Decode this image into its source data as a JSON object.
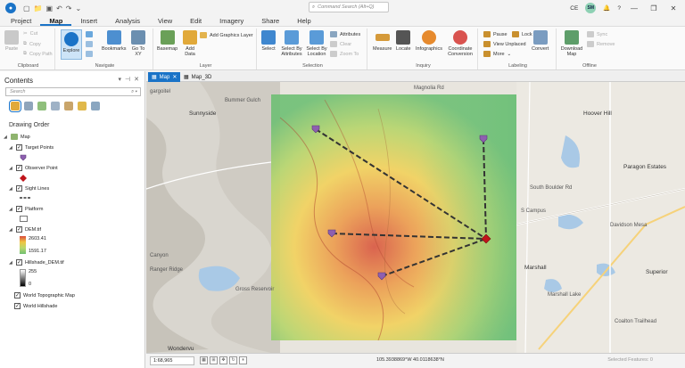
{
  "titlebar": {
    "command_search": "Command Search (Alt+Q)",
    "user_initials": "CE",
    "avatar_initials": "SM",
    "help": "?",
    "minimize": "—",
    "restore": "❐",
    "close": "✕"
  },
  "ribbon_tabs": [
    "Project",
    "Map",
    "Insert",
    "Analysis",
    "View",
    "Edit",
    "Imagery",
    "Share",
    "Help"
  ],
  "ribbon": {
    "clipboard": {
      "label": "Clipboard",
      "paste": "Paste",
      "cut": "Cut",
      "copy": "Copy",
      "copy_path": "Copy Path"
    },
    "navigate": {
      "label": "Navigate",
      "explore": "Explore",
      "bookmarks": "Bookmarks",
      "goto": "Go To XY"
    },
    "layer": {
      "label": "Layer",
      "basemap": "Basemap",
      "add_data": "Add Data",
      "add_graphics": "Add Graphics Layer"
    },
    "selection": {
      "label": "Selection",
      "select": "Select",
      "by_attr": "Select By Attributes",
      "by_loc": "Select By Location",
      "attributes": "Attributes",
      "clear": "Clear",
      "zoom_to": "Zoom To"
    },
    "inquiry": {
      "label": "Inquiry",
      "measure": "Measure",
      "locate": "Locate",
      "infographics": "Infographics",
      "coord_conv": "Coordinate Conversion"
    },
    "labeling": {
      "label": "Labeling",
      "pause": "Pause",
      "lock": "Lock",
      "view_unplaced": "View Unplaced",
      "more": "More",
      "convert": "Convert"
    },
    "offline": {
      "label": "Offline",
      "download": "Download Map",
      "sync": "Sync",
      "remove": "Remove"
    }
  },
  "contents": {
    "title": "Contents",
    "search_placeholder": "Search",
    "drawing_order": "Drawing Order",
    "map_name": "Map",
    "layers": {
      "target_points": "Target Points",
      "observer_point": "Observer Point",
      "sight_lines": "Sight Lines",
      "platform": "Platform",
      "dem": "DEM.tif",
      "dem_high": "2603.41",
      "dem_low": "1591.17",
      "hillshade": "Hillshade_DEM.tif",
      "hs_high": "255",
      "hs_low": "0",
      "topo": "World Topographic Map",
      "world_hillshade": "World Hillshade"
    }
  },
  "map_tabs": {
    "map": "Map",
    "map3d": "Map_3D"
  },
  "map_labels": {
    "gargoitel": "gargoitel",
    "sunnyside": "Sunnyside",
    "bummer_gulch": "Bummer Gulch",
    "magnolia": "Magnolia Rd",
    "hoover_hill": "Hoover Hill",
    "paragon": "Paragon Estates",
    "south_boulder": "South Boulder Rd",
    "marshall": "Marshall",
    "superior": "Superior",
    "gross_reservoir": "Gross Reservoir",
    "wondervu": "Wondervu",
    "ranger_ridge": "Ranger Ridge",
    "davidson_mesa": "Davidson Mesa",
    "marshall_lake": "Marshall Lake",
    "coalton": "Coalton Trailhead",
    "s_campus": "S Campus",
    "canyon": "Canyon"
  },
  "status": {
    "scale": "1:68,965",
    "coordinates": "105.3938869°W 40.0118638°N",
    "selected": "Selected Features: 0"
  }
}
